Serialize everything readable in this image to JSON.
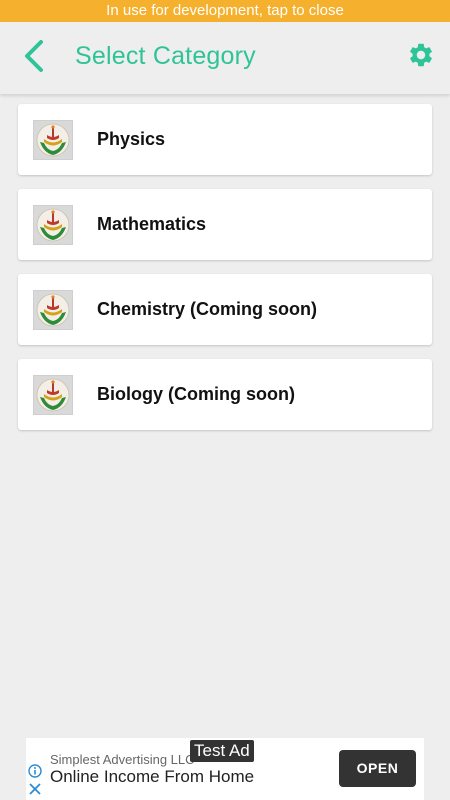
{
  "dev_banner": {
    "text": "In use for development, tap to close"
  },
  "app_bar": {
    "title": "Select Category",
    "accent_color": "#2fc497"
  },
  "categories": [
    {
      "label": "Physics"
    },
    {
      "label": "Mathematics"
    },
    {
      "label": "Chemistry (Coming soon)"
    },
    {
      "label": "Biology (Coming soon)"
    }
  ],
  "ad": {
    "advertiser": "Simplest Advertising LLC",
    "test_badge": "Test Ad",
    "headline": "Online Income From Home",
    "cta_label": "OPEN"
  },
  "icons": {
    "back": "chevron-left-icon",
    "settings": "gear-icon",
    "category": "emblem-logo",
    "ad_info": "info-icon",
    "ad_close": "close-icon"
  }
}
